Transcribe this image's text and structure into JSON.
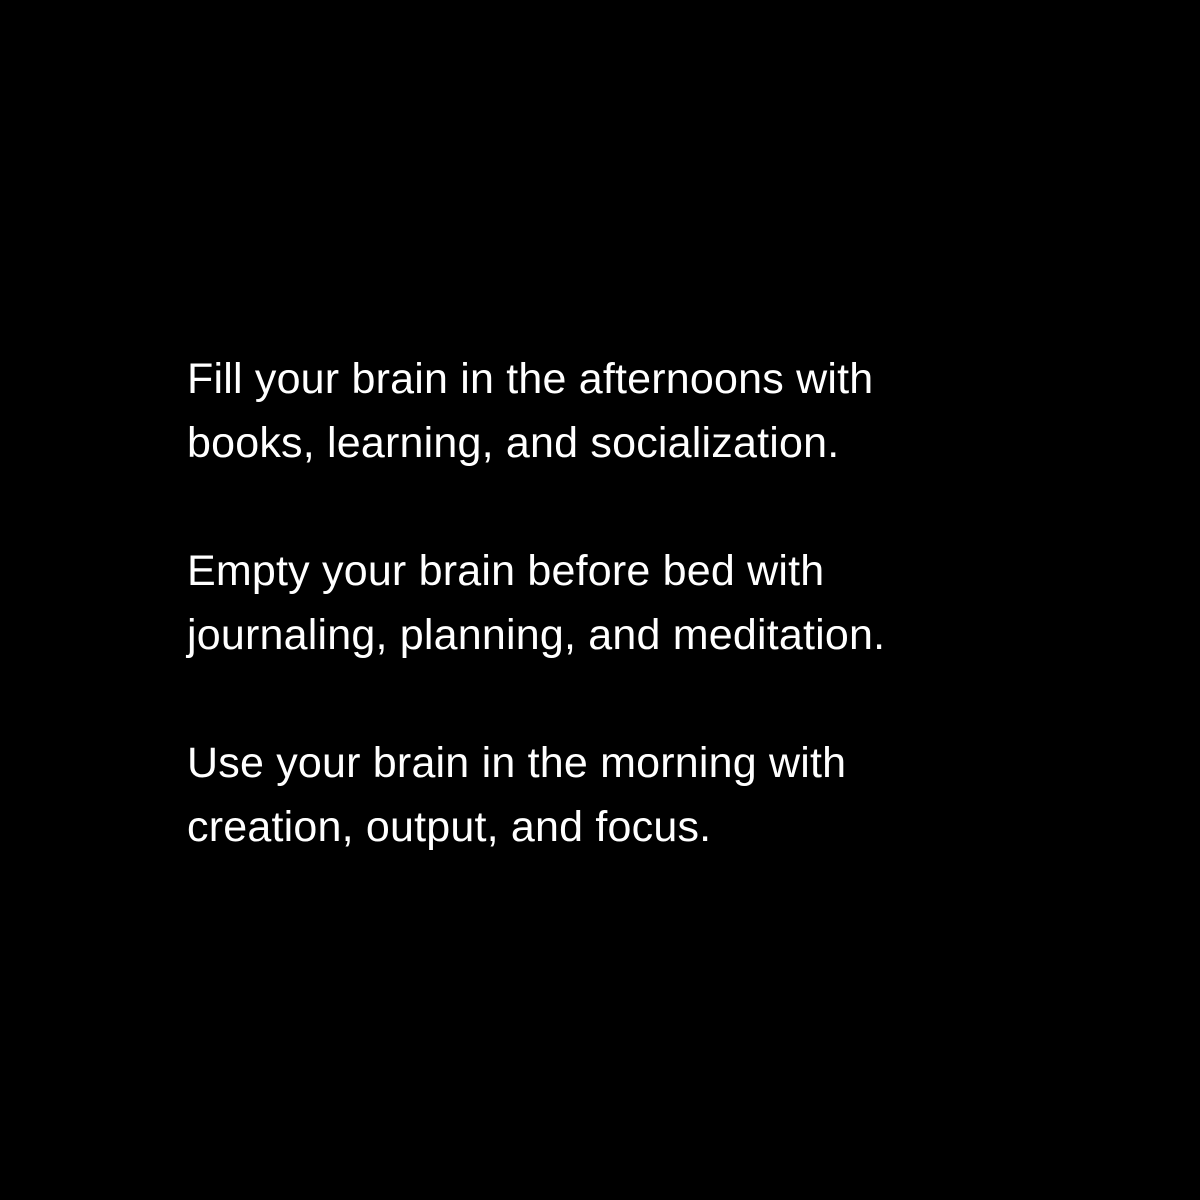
{
  "background_color": "#000000",
  "text_color": "#ffffff",
  "paragraphs": [
    {
      "lines": [
        "Fill your brain in the afternoons with",
        "books, learning, and socialization."
      ]
    },
    {
      "lines": [
        "Empty your brain before bed with",
        "journaling, planning, and meditation."
      ]
    },
    {
      "lines": [
        "Use your brain in the morning with",
        "creation, output, and focus."
      ]
    }
  ]
}
